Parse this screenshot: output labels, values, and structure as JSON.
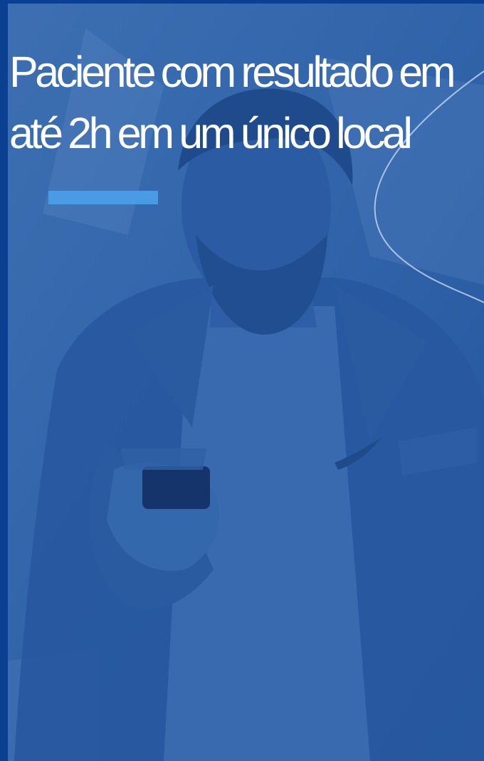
{
  "hero": {
    "headline": "Paciente com resultado em\naté 2h em um único local",
    "accent_color": "#4a9be6",
    "overlay_color": "#2f62a8",
    "frame_color": "#0b3f91",
    "image": "man-looking-at-smartphone"
  }
}
